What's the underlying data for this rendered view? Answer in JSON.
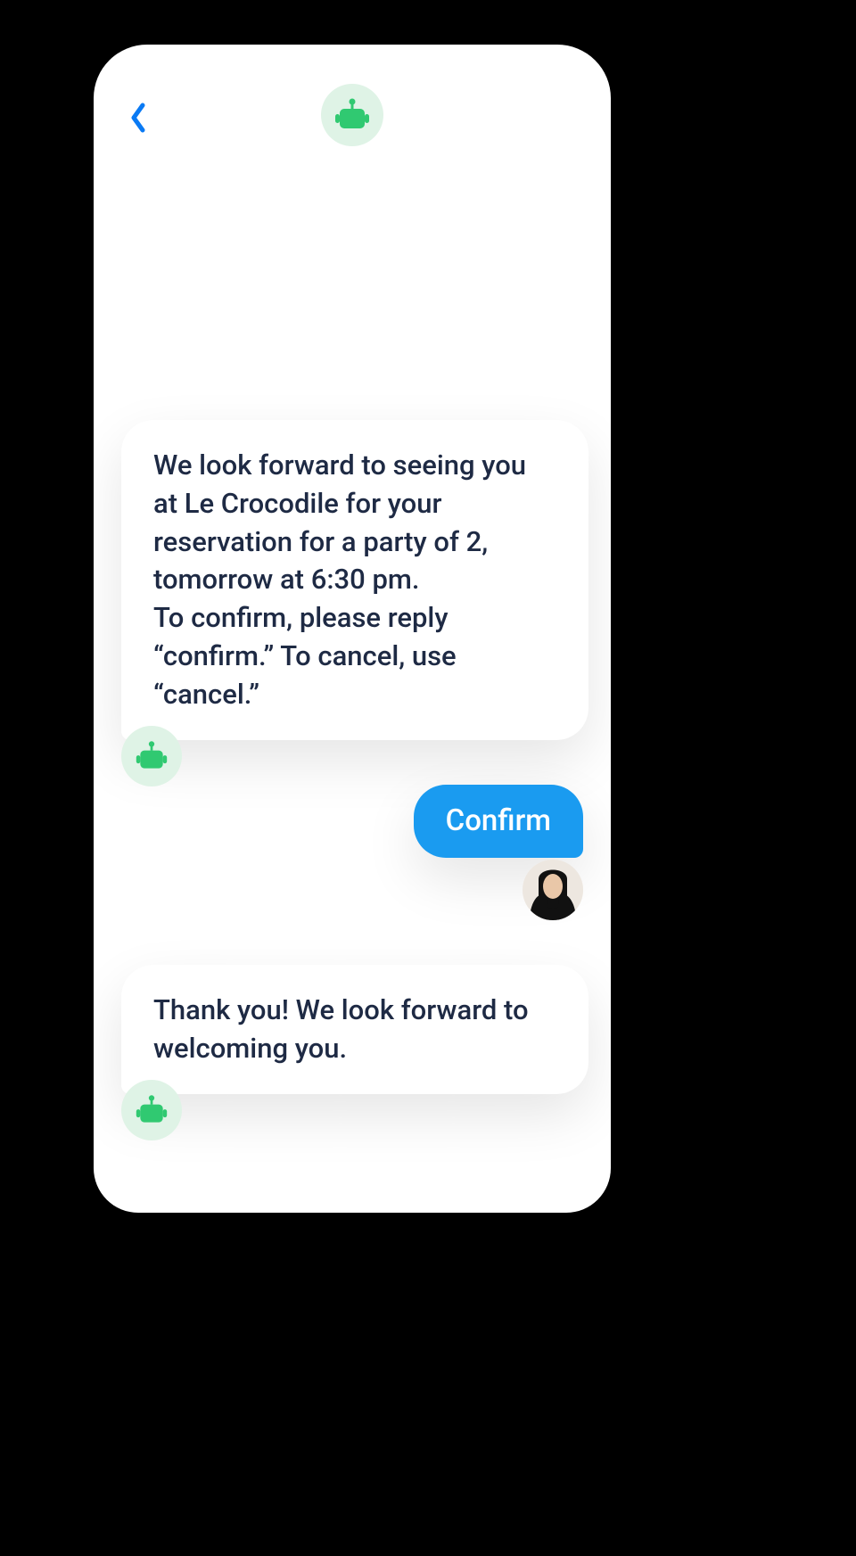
{
  "header": {
    "back_icon": "chevron-left",
    "avatar_icon": "robot"
  },
  "messages": {
    "bot1": "We look forward to seeing you at Le Crocodile for your reservation for a party of 2, tomorrow at 6:30 pm.\nTo confirm, please reply “confirm.” To cancel, use “cancel.”",
    "user1": "Confirm",
    "bot2": "Thank you! We look forward to welcoming you."
  },
  "colors": {
    "accent_blue": "#1a9bf0",
    "link_blue": "#0a7af4",
    "bot_avatar_bg": "#dff3e6",
    "bot_green": "#30c971",
    "text": "#1e2a44"
  }
}
